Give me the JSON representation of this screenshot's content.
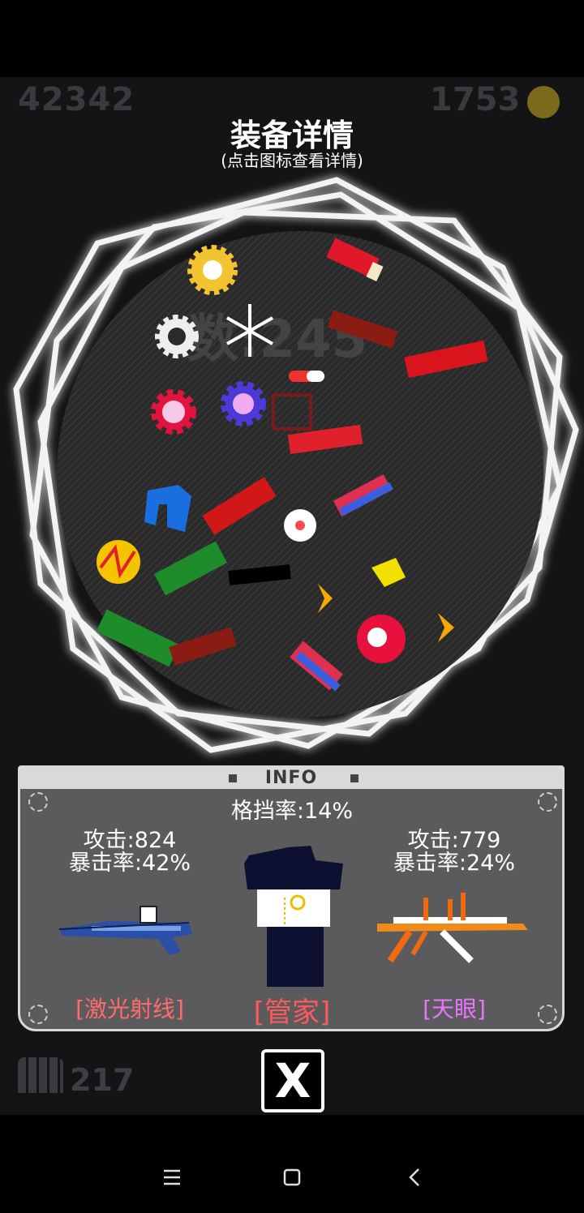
{
  "background": {
    "score": "42342",
    "coins": "1753",
    "ammo": "217"
  },
  "dialog": {
    "title": "装备详情",
    "subtitle": "(点击图标查看详情)",
    "close_label": "X"
  },
  "info_panel": {
    "header": "INFO",
    "block_rate": "格挡率:14%",
    "left_weapon": {
      "attack": "攻击:824",
      "crit": "暴击率:42%",
      "name": "[激光射线]",
      "name_color": "#ff6b6b"
    },
    "character": {
      "name": "[管家]",
      "name_color": "#ff5a5a"
    },
    "right_weapon": {
      "attack": "攻击:779",
      "crit": "暴击率:24%",
      "name": "[天眼]",
      "name_color": "#e873ff"
    }
  },
  "navbar": {
    "menu_icon": "menu-icon",
    "home_icon": "home-square-icon",
    "back_icon": "back-chevron-icon"
  },
  "colors": {
    "panel_bg": "#5b5b5d",
    "panel_border": "#d8d8d8",
    "orb_glow": "#ffffff"
  }
}
